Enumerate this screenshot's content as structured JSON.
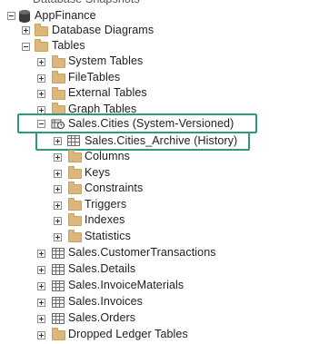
{
  "tree": {
    "top_partial": "Database Snapshots",
    "database": "AppFinance",
    "folders_l1": {
      "diagrams": "Database Diagrams",
      "tables": "Tables"
    },
    "tables_children": {
      "system": "System Tables",
      "file": "FileTables",
      "external": "External Tables",
      "graph": "Graph Tables"
    },
    "selected_table": "Sales.Cities (System-Versioned)",
    "archive_table": "Sales.Cities_Archive (History)",
    "table_subfolders": [
      "Columns",
      "Keys",
      "Constraints",
      "Triggers",
      "Indexes",
      "Statistics"
    ],
    "other_tables": [
      "Sales.CustomerTransactions",
      "Sales.Details",
      "Sales.InvoiceMaterials",
      "Sales.Invoices",
      "Sales.Orders"
    ],
    "dropped_ledger": "Dropped Ledger Tables"
  },
  "colors": {
    "highlight": "#2e9a7b",
    "folder": "#dcb67a"
  }
}
